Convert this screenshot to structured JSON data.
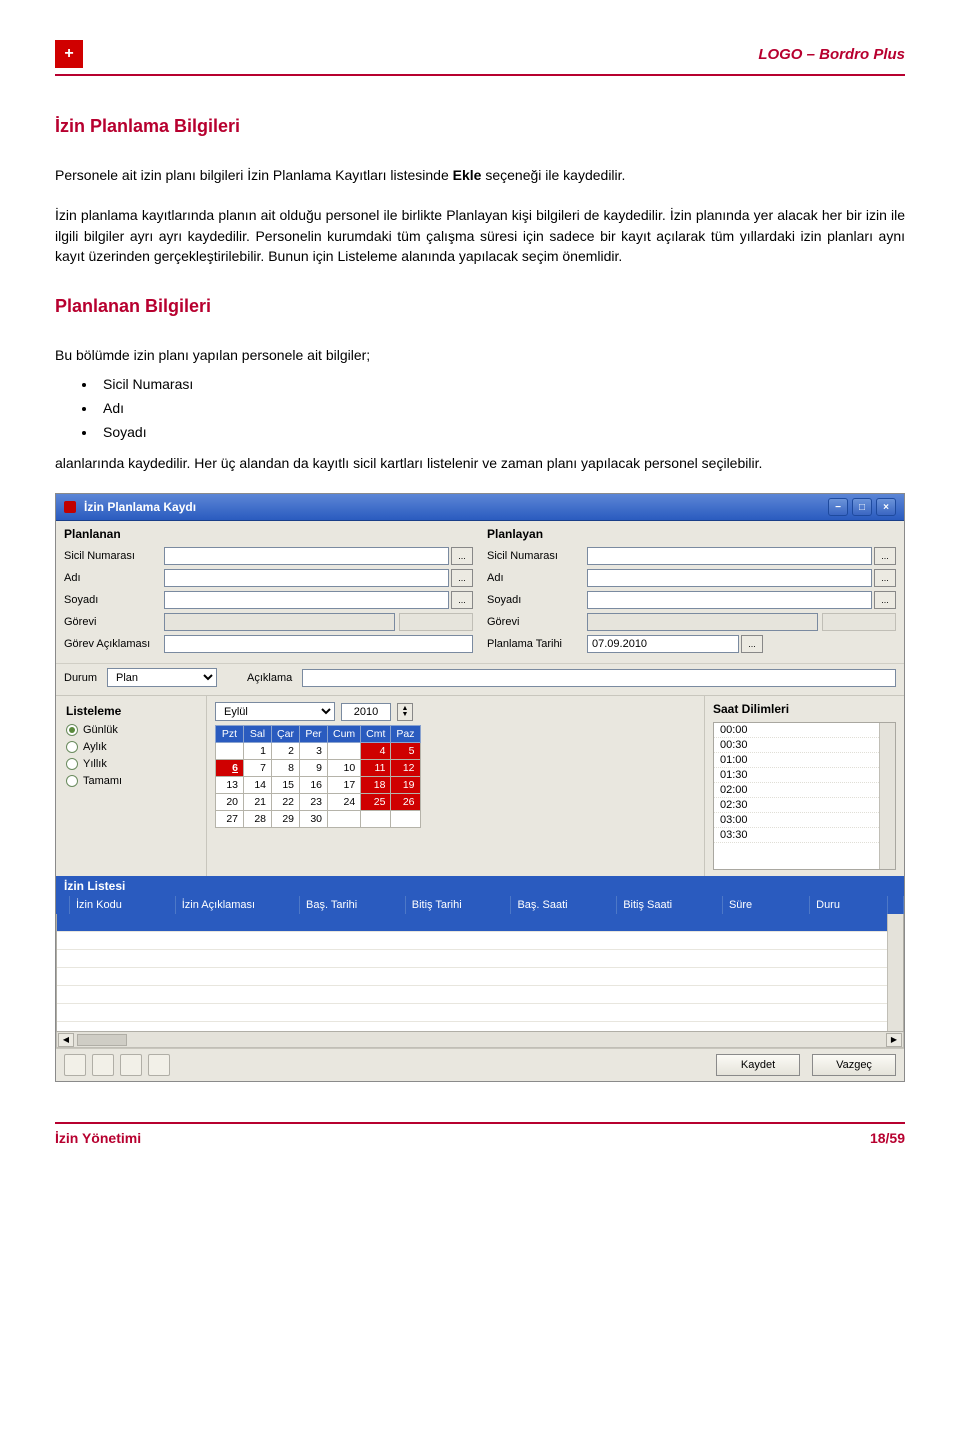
{
  "header": {
    "logo_plus": "+",
    "right": "LOGO – Bordro Plus"
  },
  "section1": {
    "title": "İzin Planlama Bilgileri",
    "para1_pre": "Personele ait izin planı bilgileri İzin Planlama Kayıtları listesinde ",
    "para1_bold": "Ekle",
    "para1_post": " seçeneği ile kaydedilir.",
    "para2": "İzin planlama kayıtlarında planın ait olduğu personel ile birlikte Planlayan kişi bilgileri de kaydedilir. İzin planında yer alacak her bir izin ile ilgili bilgiler ayrı ayrı kaydedilir. Personelin kurumdaki tüm çalışma süresi için sadece bir kayıt açılarak tüm yıllardaki izin planları aynı kayıt üzerinden gerçekleştirilebilir. Bunun için Listeleme alanında yapılacak seçim önemlidir."
  },
  "section2": {
    "title": "Planlanan Bilgileri",
    "intro": "Bu bölümde izin planı yapılan personele ait bilgiler;",
    "bullets": [
      "Sicil Numarası",
      "Adı",
      "Soyadı"
    ],
    "outro": "alanlarında kaydedilir. Her üç alandan da kayıtlı sicil kartları listelenir ve zaman planı yapılacak personel seçilebilir."
  },
  "app": {
    "title": "İzin Planlama Kaydı",
    "planlanan": {
      "heading": "Planlanan",
      "sicil": "Sicil Numarası",
      "adi": "Adı",
      "soyadi": "Soyadı",
      "gorevi": "Görevi",
      "gorev_aciklamasi": "Görev Açıklaması"
    },
    "planlayan": {
      "heading": "Planlayan",
      "sicil": "Sicil Numarası",
      "adi": "Adı",
      "soyadi": "Soyadı",
      "gorevi": "Görevi",
      "planlama_tarihi": "Planlama Tarihi",
      "planlama_tarihi_val": "07.09.2010"
    },
    "durum": {
      "label": "Durum",
      "value": "Plan",
      "aciklama_label": "Açıklama"
    },
    "listeleme": {
      "heading": "Listeleme",
      "gunluk": "Günlük",
      "aylik": "Aylık",
      "yillik": "Yıllık",
      "tamami": "Tamamı"
    },
    "calendar": {
      "month": "Eylül",
      "year": "2010",
      "days": [
        "Pzt",
        "Sal",
        "Çar",
        "Per",
        "Cum",
        "Cmt",
        "Paz"
      ],
      "weeks": [
        [
          "",
          "1",
          "2",
          "3",
          "4",
          "5"
        ],
        [
          "6",
          "7",
          "8",
          "9",
          "10",
          "11",
          "12"
        ],
        [
          "13",
          "14",
          "15",
          "16",
          "17",
          "18",
          "19"
        ],
        [
          "20",
          "21",
          "22",
          "23",
          "24",
          "25",
          "26"
        ],
        [
          "27",
          "28",
          "29",
          "30",
          "",
          "",
          ""
        ]
      ]
    },
    "saat": {
      "heading": "Saat Dilimleri",
      "slots": [
        "00:00",
        "00:30",
        "01:00",
        "01:30",
        "02:00",
        "02:30",
        "03:00",
        "03:30"
      ]
    },
    "izin_listesi": "İzin Listesi",
    "grid_cols": [
      "İzin Kodu",
      "İzin Açıklaması",
      "Baş. Tarihi",
      "Bitiş Tarihi",
      "Baş. Saati",
      "Bitiş Saati",
      "Süre",
      "Duru"
    ],
    "buttons": {
      "kaydet": "Kaydet",
      "vazgec": "Vazgeç"
    }
  },
  "footer": {
    "left": "İzin Yönetimi",
    "right": "18/59"
  }
}
